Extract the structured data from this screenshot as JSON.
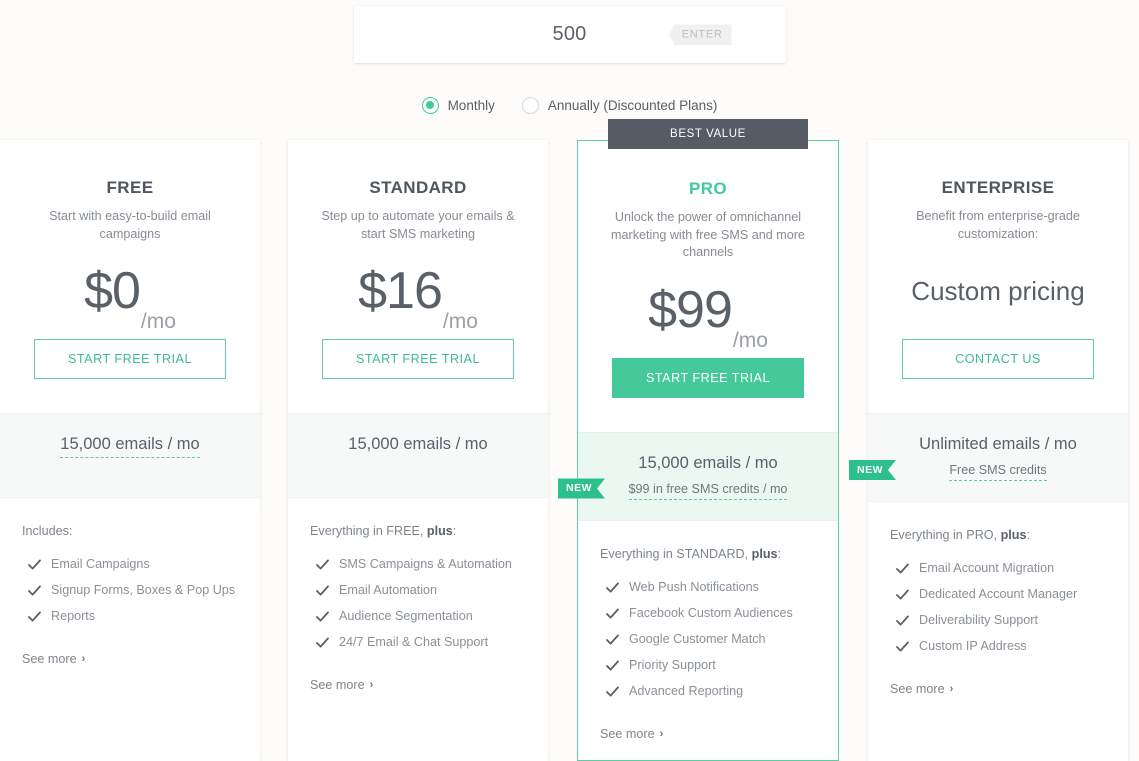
{
  "contacts": {
    "value": "500",
    "placeholder": "500",
    "enter_label": "ENTER"
  },
  "billing": {
    "options": [
      {
        "label": "Monthly",
        "selected": true
      },
      {
        "label": "Annually (Discounted Plans)",
        "selected": false
      }
    ]
  },
  "colors": {
    "accent_green": "#3fcc98",
    "button_green": "#45c99a",
    "badge_green": "#2ec08a",
    "banner_dark": "#555c63",
    "page_bg": "#fdfcfa",
    "band_bg": "#f7f8f8",
    "band_bg_featured": "#ebf8f2"
  },
  "plans": [
    {
      "name": "FREE",
      "description": "Start with easy-to-build email campaigns",
      "price_amount": "$0",
      "price_per": "/mo",
      "cta_label": "START FREE TRIAL",
      "emails_main": "15,000 emails / mo",
      "emails_sub": null,
      "new_badge": null,
      "features_intro_plain": "Includes:",
      "features_intro_prefix": "Includes:",
      "features_intro_bold": "",
      "features_intro_suffix": "",
      "features": [
        "Email Campaigns",
        "Signup Forms, Boxes & Pop Ups",
        "Reports"
      ],
      "see_more": "See more",
      "featured": false,
      "badge": null
    },
    {
      "name": "STANDARD",
      "description": "Step up to automate your emails & start SMS marketing",
      "price_amount": "$16",
      "price_per": "/mo",
      "cta_label": "START FREE TRIAL",
      "emails_main": "15,000 emails / mo",
      "emails_sub": null,
      "new_badge": null,
      "features_intro_prefix": "Everything in FREE, ",
      "features_intro_bold": "plus",
      "features_intro_suffix": ":",
      "features": [
        "SMS Campaigns & Automation",
        "Email Automation",
        "Audience Segmentation",
        "24/7 Email & Chat Support"
      ],
      "see_more": "See more",
      "featured": false,
      "badge": null
    },
    {
      "name": "PRO",
      "description": "Unlock the power of omnichannel marketing with free SMS and more channels",
      "price_amount": "$99",
      "price_per": "/mo",
      "cta_label": "START FREE TRIAL",
      "emails_main": "15,000 emails / mo",
      "emails_sub": "$99 in free SMS credits / mo",
      "new_badge": "NEW",
      "features_intro_prefix": "Everything in STANDARD, ",
      "features_intro_bold": "plus",
      "features_intro_suffix": ":",
      "features": [
        "Web Push Notifications",
        "Facebook Custom Audiences",
        "Google Customer Match",
        "Priority Support",
        "Advanced Reporting"
      ],
      "see_more": "See more",
      "featured": true,
      "badge": "BEST VALUE"
    },
    {
      "name": "ENTERPRISE",
      "description": "Benefit from enterprise-grade customization:",
      "price_amount": "Custom pricing",
      "price_per": "",
      "cta_label": "CONTACT US",
      "emails_main": "Unlimited emails / mo",
      "emails_sub": "Free SMS credits",
      "new_badge": "NEW",
      "features_intro_prefix": "Everything in PRO, ",
      "features_intro_bold": "plus",
      "features_intro_suffix": ":",
      "features": [
        "Email Account Migration",
        "Dedicated Account Manager",
        "Deliverability Support",
        "Custom IP Address"
      ],
      "see_more": "See more",
      "featured": false,
      "badge": null
    }
  ],
  "icons": {
    "check": "check-icon",
    "chevron_right": "chevron-right-icon"
  }
}
